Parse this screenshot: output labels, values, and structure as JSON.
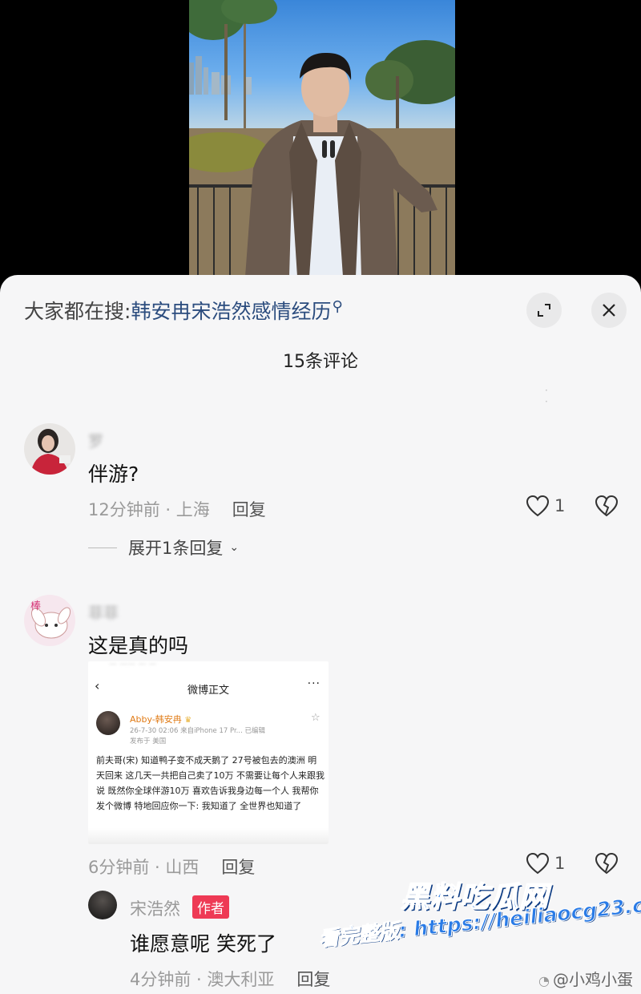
{
  "search": {
    "prefix": "大家都在搜:",
    "keyword": "韩安冉宋浩然感情经历"
  },
  "sheet": {
    "title": "15条评论"
  },
  "comments": [
    {
      "author": "罗",
      "text": "伴游?",
      "time_location": "12分钟前 · 上海",
      "reply_label": "回复",
      "likes": "1",
      "expand_label": "展开1条回复"
    },
    {
      "author": "菲菲",
      "text": "这是真的吗",
      "time_location": "6分钟前 · 山西",
      "reply_label": "回复",
      "likes": "1",
      "screenshot": {
        "header_title": "微博正文",
        "more": "···",
        "poster_name": "Abby-韩安冉",
        "crown": "♛",
        "time_device": "26-7-30 02:06  来自iPhone 17 Pr...  已编辑",
        "location": "发布于 美国",
        "body": "前夫哥(宋) 知道鸭子变不成天鹅了 27号被包去的澳洲 明天回来 这几天一共把自己卖了10万 不需要让每个人来跟我说 既然你全球伴游10万 喜欢告诉我身边每一个人 我帮你发个微博 特地回应你一下:  我知道了 全世界也知道了"
      },
      "reply": {
        "author": "宋浩然",
        "badge": "作者",
        "text": "谁愿意呢 笑死了",
        "time_location": "4分钟前 · 澳大利亚",
        "reply_label": "回复"
      }
    }
  ],
  "watermark": {
    "brand": "黑料吃瓜网",
    "url_text": "看完整版: https://heiliaocg23.com",
    "weibo_user": "@小鸡小蛋"
  },
  "colors": {
    "sheet_bg": "#f6f6f7",
    "keyword": "#2b4c7e",
    "badge": "#ee3a55",
    "watermark_blue": "#2a7be6"
  }
}
